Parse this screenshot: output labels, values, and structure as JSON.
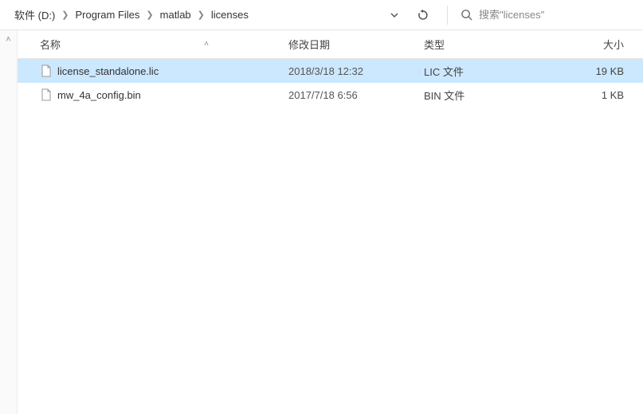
{
  "breadcrumb": [
    {
      "label": "软件 (D:)"
    },
    {
      "label": "Program Files"
    },
    {
      "label": "matlab"
    },
    {
      "label": "licenses"
    }
  ],
  "search": {
    "placeholder": "搜索\"licenses\""
  },
  "columns": {
    "name": "名称",
    "date": "修改日期",
    "type": "类型",
    "size": "大小"
  },
  "files": [
    {
      "name": "license_standalone.lic",
      "date": "2018/3/18 12:32",
      "type": "LIC 文件",
      "size": "19 KB",
      "selected": true
    },
    {
      "name": "mw_4a_config.bin",
      "date": "2017/7/18 6:56",
      "type": "BIN 文件",
      "size": "1 KB",
      "selected": false
    }
  ]
}
